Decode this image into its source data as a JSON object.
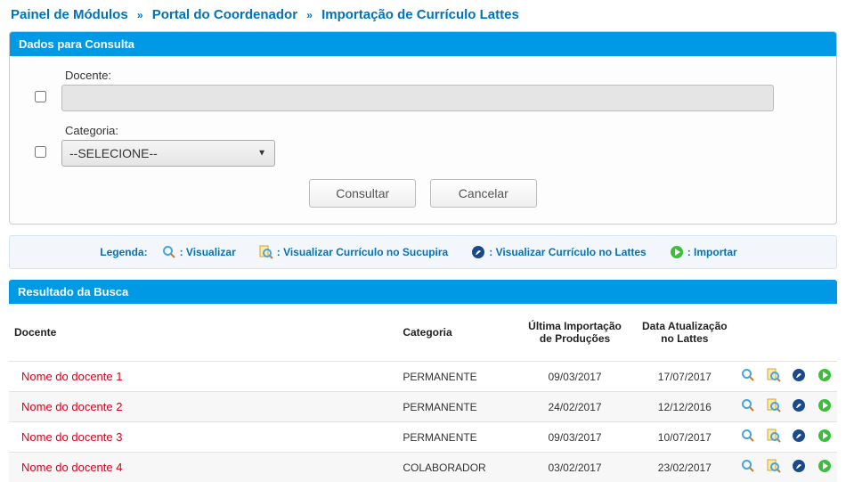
{
  "breadcrumb": {
    "a": "Painel de Módulos",
    "b": "Portal do Coordenador",
    "c": "Importação de Currículo Lattes"
  },
  "panel": {
    "title": "Dados para Consulta",
    "docente_label": "Docente:",
    "docente_value": "",
    "categoria_label": "Categoria:",
    "categoria_value": "--SELECIONE--",
    "btn_consultar": "Consultar",
    "btn_cancelar": "Cancelar"
  },
  "legend": {
    "label": "Legenda:",
    "visualizar": ": Visualizar",
    "sucupira": ": Visualizar Currículo no Sucupira",
    "lattes": ": Visualizar Currículo no Lattes",
    "importar": ": Importar"
  },
  "results": {
    "title": "Resultado da Busca",
    "headers": {
      "docente": "Docente",
      "categoria": "Categoria",
      "ultima": "Última Importação de Produções",
      "data_att": "Data Atualização no Lattes"
    },
    "rows": [
      {
        "nome": "Nome do docente 1",
        "categoria": "PERMANENTE",
        "ultima": "09/03/2017",
        "data_att": "17/07/2017"
      },
      {
        "nome": "Nome do docente 2",
        "categoria": "PERMANENTE",
        "ultima": "24/02/2017",
        "data_att": "12/12/2016"
      },
      {
        "nome": "Nome do docente 3",
        "categoria": "PERMANENTE",
        "ultima": "09/03/2017",
        "data_att": "10/07/2017"
      },
      {
        "nome": "Nome do docente 4",
        "categoria": "COLABORADOR",
        "ultima": "03/02/2017",
        "data_att": "23/02/2017"
      }
    ]
  }
}
